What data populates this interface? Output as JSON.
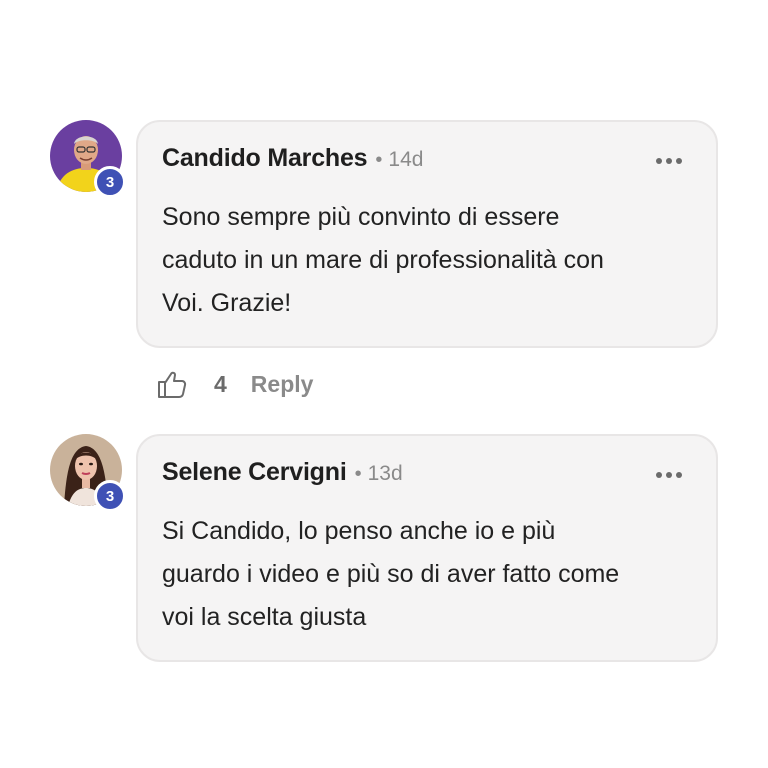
{
  "comments": [
    {
      "author": "Candido Marches",
      "time": "14d",
      "badge": "3",
      "text_lines": [
        "Sono sempre più convinto di essere",
        "caduto in un mare di professionalità con",
        "Voi. Grazie!"
      ],
      "likes": "4",
      "reply_label": "Reply",
      "avatar_icon": "avatar-man-yellow-shirt",
      "avatar_bg": "#6a3fa0"
    },
    {
      "author": "Selene Cervigni",
      "time": "13d",
      "badge": "3",
      "text_lines": [
        "Si Candido, lo penso anche io e più",
        "guardo i video e più so di aver fatto come",
        "voi la scelta giusta"
      ],
      "avatar_icon": "avatar-woman",
      "avatar_bg": "#c9b29a"
    }
  ],
  "colors": {
    "bubble_bg": "#f5f4f4",
    "badge": "#3f51b5",
    "muted": "#8a8a8a"
  }
}
